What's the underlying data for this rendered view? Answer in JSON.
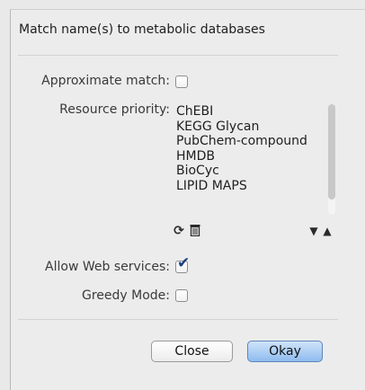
{
  "dialog": {
    "title": "Match name(s) to metabolic databases",
    "approximate_match": {
      "label": "Approximate match:",
      "checked": false
    },
    "resource_priority": {
      "label": "Resource priority:",
      "items": [
        "ChEBI",
        "KEGG Glycan",
        "PubChem-compound",
        "HMDB",
        "BioCyc",
        "LIPID MAPS"
      ],
      "controls": {
        "refresh_glyph": "⟳",
        "trash_glyph": "🗑",
        "move_down_glyph": "▼",
        "move_up_glyph": "▲"
      }
    },
    "allow_web_services": {
      "label": "Allow Web services:",
      "checked": true,
      "check_glyph": "✔"
    },
    "greedy_mode": {
      "label": "Greedy Mode:",
      "checked": false
    },
    "buttons": {
      "close": "Close",
      "okay": "Okay"
    }
  },
  "colors": {
    "background": "#ececec",
    "okay_button": "#8fbcef",
    "check_mark": "#1d3f7e"
  }
}
